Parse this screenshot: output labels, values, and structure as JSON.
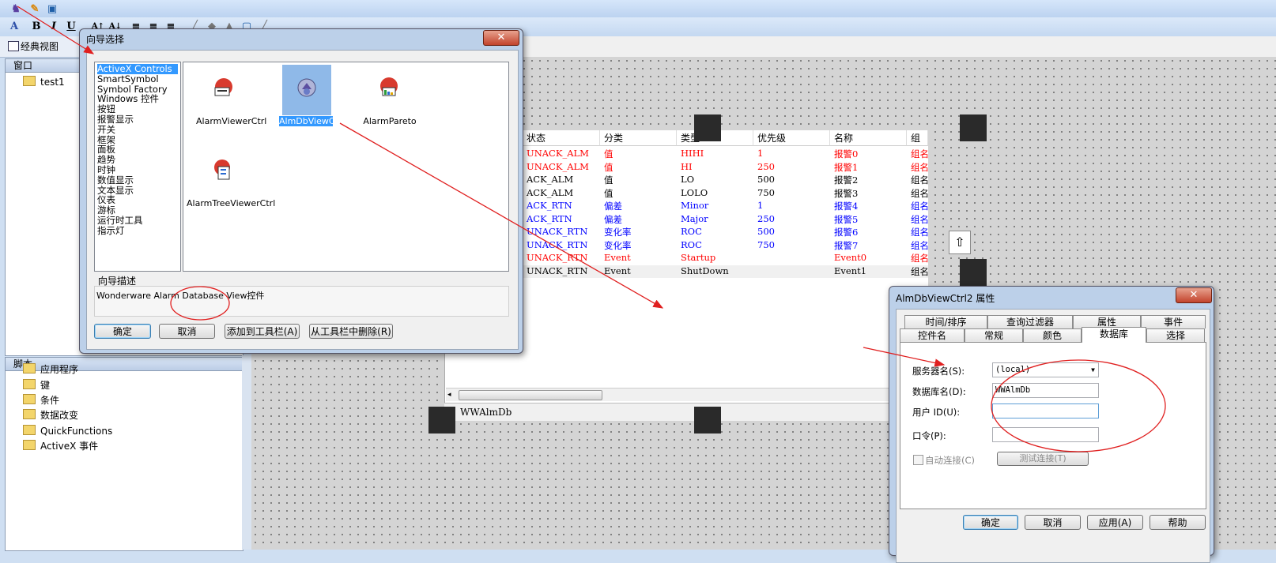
{
  "colors": {
    "alarm_red": "#ff0000",
    "alarm_blue": "#0000ff",
    "annotation": "#e02020",
    "selection": "#3399ff"
  },
  "classic_view_tab": "经典视图",
  "window_panel": {
    "title": "窗口",
    "items": [
      "test1"
    ]
  },
  "script_panel": {
    "title": "脚本",
    "items": [
      "应用程序",
      "键",
      "条件",
      "数据改变",
      "QuickFunctions",
      "ActiveX 事件"
    ]
  },
  "wizard": {
    "title": "向导选择",
    "categories": [
      "ActiveX Controls",
      "SmartSymbol",
      "Symbol Factory",
      "Windows 控件",
      "按钮",
      "报警显示",
      "开关",
      "框架",
      "面板",
      "趋势",
      "时钟",
      "数值显示",
      "文本显示",
      "仪表",
      "游标",
      "运行时工具",
      "指示灯"
    ],
    "controls": [
      "AlarmViewerCtrl",
      "AlmDbViewCtrl",
      "AlarmPareto",
      "AlarmTreeViewerCtrl"
    ],
    "selected_control": "AlmDbViewCtrl",
    "description_label": "向导描述",
    "description": "Wonderware Alarm Database View控件",
    "buttons": {
      "ok": "确定",
      "cancel": "取消",
      "add": "添加到工具栏(A)",
      "remove": "从工具栏中删除(R)"
    }
  },
  "alarm_table": {
    "headers": [
      "状态",
      "分类",
      "类型",
      "优先级",
      "名称",
      "组"
    ],
    "rows": [
      {
        "status": "UNACK_ALM",
        "category": "值",
        "type": "HIHI",
        "priority": "1",
        "name": "报警0",
        "group": "组名",
        "color": "red"
      },
      {
        "status": "UNACK_ALM",
        "category": "值",
        "type": "HI",
        "priority": "250",
        "name": "报警1",
        "group": "组名",
        "color": "red"
      },
      {
        "status": "ACK_ALM",
        "category": "值",
        "type": "LO",
        "priority": "500",
        "name": "报警2",
        "group": "组名",
        "color": "black"
      },
      {
        "status": "ACK_ALM",
        "category": "值",
        "type": "LOLO",
        "priority": "750",
        "name": "报警3",
        "group": "组名",
        "color": "black"
      },
      {
        "status": "ACK_RTN",
        "category": "偏差",
        "type": "Minor",
        "priority": "1",
        "name": "报警4",
        "group": "组名",
        "color": "blue"
      },
      {
        "status": "ACK_RTN",
        "category": "偏差",
        "type": "Major",
        "priority": "250",
        "name": "报警5",
        "group": "组名",
        "color": "blue"
      },
      {
        "status": "UNACK_RTN",
        "category": "变化率",
        "type": "ROC",
        "priority": "500",
        "name": "报警6",
        "group": "组名",
        "color": "blue"
      },
      {
        "status": "UNACK_RTN",
        "category": "变化率",
        "type": "ROC",
        "priority": "750",
        "name": "报警7",
        "group": "组名",
        "color": "blue"
      },
      {
        "status": "UNACK_RTN",
        "category": "Event",
        "type": "Startup",
        "priority": "",
        "name": "Event0",
        "group": "组名",
        "color": "red"
      },
      {
        "status": "UNACK_RTN",
        "category": "Event",
        "type": "ShutDown",
        "priority": "",
        "name": "Event1",
        "group": "组名",
        "color": "black"
      }
    ],
    "status_value": "WWAlmDb"
  },
  "props": {
    "title": "AlmDbViewCtrl2 属性",
    "tabs_row1": [
      "时间/排序",
      "查询过滤器",
      "属性",
      "事件"
    ],
    "tabs_row2": [
      "控件名",
      "常规",
      "颜色",
      "数据库",
      "选择"
    ],
    "active_tab": "数据库",
    "server_label": "服务器名(S):",
    "server_value": "(local)",
    "db_label": "数据库名(D):",
    "db_value": "WWAlmDb",
    "user_label": "用户 ID(U):",
    "user_value": "",
    "pwd_label": "口令(P):",
    "auto_connect": "自动连接(C)",
    "test_connect": "测试连接(T)",
    "buttons": {
      "ok": "确定",
      "cancel": "取消",
      "apply": "应用(A)",
      "help": "帮助"
    }
  }
}
